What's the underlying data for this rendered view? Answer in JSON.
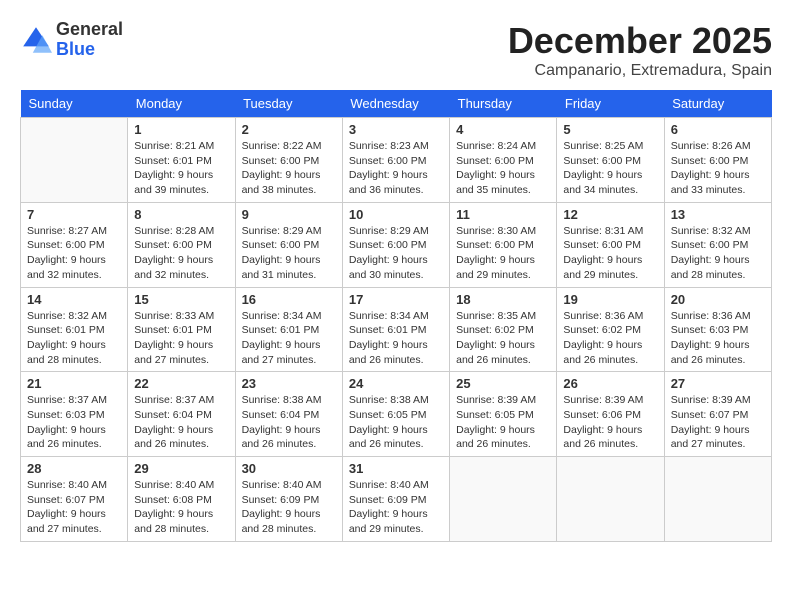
{
  "header": {
    "logo": {
      "line1": "General",
      "line2": "Blue"
    },
    "title": "December 2025",
    "subtitle": "Campanario, Extremadura, Spain"
  },
  "days_of_week": [
    "Sunday",
    "Monday",
    "Tuesday",
    "Wednesday",
    "Thursday",
    "Friday",
    "Saturday"
  ],
  "weeks": [
    [
      {
        "day": "",
        "info": ""
      },
      {
        "day": "1",
        "info": "Sunrise: 8:21 AM\nSunset: 6:01 PM\nDaylight: 9 hours\nand 39 minutes."
      },
      {
        "day": "2",
        "info": "Sunrise: 8:22 AM\nSunset: 6:00 PM\nDaylight: 9 hours\nand 38 minutes."
      },
      {
        "day": "3",
        "info": "Sunrise: 8:23 AM\nSunset: 6:00 PM\nDaylight: 9 hours\nand 36 minutes."
      },
      {
        "day": "4",
        "info": "Sunrise: 8:24 AM\nSunset: 6:00 PM\nDaylight: 9 hours\nand 35 minutes."
      },
      {
        "day": "5",
        "info": "Sunrise: 8:25 AM\nSunset: 6:00 PM\nDaylight: 9 hours\nand 34 minutes."
      },
      {
        "day": "6",
        "info": "Sunrise: 8:26 AM\nSunset: 6:00 PM\nDaylight: 9 hours\nand 33 minutes."
      }
    ],
    [
      {
        "day": "7",
        "info": "Sunrise: 8:27 AM\nSunset: 6:00 PM\nDaylight: 9 hours\nand 32 minutes."
      },
      {
        "day": "8",
        "info": "Sunrise: 8:28 AM\nSunset: 6:00 PM\nDaylight: 9 hours\nand 32 minutes."
      },
      {
        "day": "9",
        "info": "Sunrise: 8:29 AM\nSunset: 6:00 PM\nDaylight: 9 hours\nand 31 minutes."
      },
      {
        "day": "10",
        "info": "Sunrise: 8:29 AM\nSunset: 6:00 PM\nDaylight: 9 hours\nand 30 minutes."
      },
      {
        "day": "11",
        "info": "Sunrise: 8:30 AM\nSunset: 6:00 PM\nDaylight: 9 hours\nand 29 minutes."
      },
      {
        "day": "12",
        "info": "Sunrise: 8:31 AM\nSunset: 6:00 PM\nDaylight: 9 hours\nand 29 minutes."
      },
      {
        "day": "13",
        "info": "Sunrise: 8:32 AM\nSunset: 6:00 PM\nDaylight: 9 hours\nand 28 minutes."
      }
    ],
    [
      {
        "day": "14",
        "info": "Sunrise: 8:32 AM\nSunset: 6:01 PM\nDaylight: 9 hours\nand 28 minutes."
      },
      {
        "day": "15",
        "info": "Sunrise: 8:33 AM\nSunset: 6:01 PM\nDaylight: 9 hours\nand 27 minutes."
      },
      {
        "day": "16",
        "info": "Sunrise: 8:34 AM\nSunset: 6:01 PM\nDaylight: 9 hours\nand 27 minutes."
      },
      {
        "day": "17",
        "info": "Sunrise: 8:34 AM\nSunset: 6:01 PM\nDaylight: 9 hours\nand 26 minutes."
      },
      {
        "day": "18",
        "info": "Sunrise: 8:35 AM\nSunset: 6:02 PM\nDaylight: 9 hours\nand 26 minutes."
      },
      {
        "day": "19",
        "info": "Sunrise: 8:36 AM\nSunset: 6:02 PM\nDaylight: 9 hours\nand 26 minutes."
      },
      {
        "day": "20",
        "info": "Sunrise: 8:36 AM\nSunset: 6:03 PM\nDaylight: 9 hours\nand 26 minutes."
      }
    ],
    [
      {
        "day": "21",
        "info": "Sunrise: 8:37 AM\nSunset: 6:03 PM\nDaylight: 9 hours\nand 26 minutes."
      },
      {
        "day": "22",
        "info": "Sunrise: 8:37 AM\nSunset: 6:04 PM\nDaylight: 9 hours\nand 26 minutes."
      },
      {
        "day": "23",
        "info": "Sunrise: 8:38 AM\nSunset: 6:04 PM\nDaylight: 9 hours\nand 26 minutes."
      },
      {
        "day": "24",
        "info": "Sunrise: 8:38 AM\nSunset: 6:05 PM\nDaylight: 9 hours\nand 26 minutes."
      },
      {
        "day": "25",
        "info": "Sunrise: 8:39 AM\nSunset: 6:05 PM\nDaylight: 9 hours\nand 26 minutes."
      },
      {
        "day": "26",
        "info": "Sunrise: 8:39 AM\nSunset: 6:06 PM\nDaylight: 9 hours\nand 26 minutes."
      },
      {
        "day": "27",
        "info": "Sunrise: 8:39 AM\nSunset: 6:07 PM\nDaylight: 9 hours\nand 27 minutes."
      }
    ],
    [
      {
        "day": "28",
        "info": "Sunrise: 8:40 AM\nSunset: 6:07 PM\nDaylight: 9 hours\nand 27 minutes."
      },
      {
        "day": "29",
        "info": "Sunrise: 8:40 AM\nSunset: 6:08 PM\nDaylight: 9 hours\nand 28 minutes."
      },
      {
        "day": "30",
        "info": "Sunrise: 8:40 AM\nSunset: 6:09 PM\nDaylight: 9 hours\nand 28 minutes."
      },
      {
        "day": "31",
        "info": "Sunrise: 8:40 AM\nSunset: 6:09 PM\nDaylight: 9 hours\nand 29 minutes."
      },
      {
        "day": "",
        "info": ""
      },
      {
        "day": "",
        "info": ""
      },
      {
        "day": "",
        "info": ""
      }
    ]
  ]
}
